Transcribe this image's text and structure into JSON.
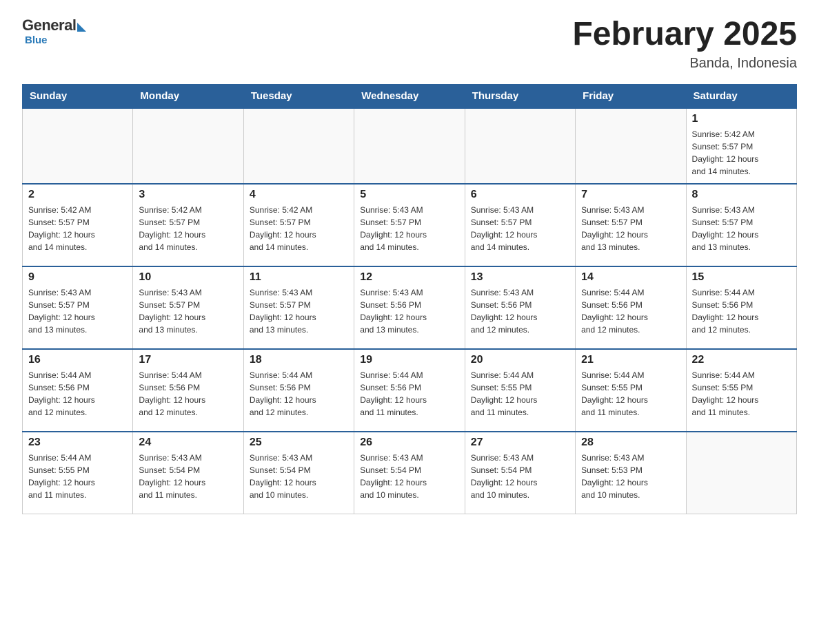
{
  "header": {
    "logo_general": "General",
    "logo_blue": "Blue",
    "month_title": "February 2025",
    "location": "Banda, Indonesia"
  },
  "weekdays": [
    "Sunday",
    "Monday",
    "Tuesday",
    "Wednesday",
    "Thursday",
    "Friday",
    "Saturday"
  ],
  "weeks": [
    [
      {
        "day": "",
        "info": ""
      },
      {
        "day": "",
        "info": ""
      },
      {
        "day": "",
        "info": ""
      },
      {
        "day": "",
        "info": ""
      },
      {
        "day": "",
        "info": ""
      },
      {
        "day": "",
        "info": ""
      },
      {
        "day": "1",
        "info": "Sunrise: 5:42 AM\nSunset: 5:57 PM\nDaylight: 12 hours\nand 14 minutes."
      }
    ],
    [
      {
        "day": "2",
        "info": "Sunrise: 5:42 AM\nSunset: 5:57 PM\nDaylight: 12 hours\nand 14 minutes."
      },
      {
        "day": "3",
        "info": "Sunrise: 5:42 AM\nSunset: 5:57 PM\nDaylight: 12 hours\nand 14 minutes."
      },
      {
        "day": "4",
        "info": "Sunrise: 5:42 AM\nSunset: 5:57 PM\nDaylight: 12 hours\nand 14 minutes."
      },
      {
        "day": "5",
        "info": "Sunrise: 5:43 AM\nSunset: 5:57 PM\nDaylight: 12 hours\nand 14 minutes."
      },
      {
        "day": "6",
        "info": "Sunrise: 5:43 AM\nSunset: 5:57 PM\nDaylight: 12 hours\nand 14 minutes."
      },
      {
        "day": "7",
        "info": "Sunrise: 5:43 AM\nSunset: 5:57 PM\nDaylight: 12 hours\nand 13 minutes."
      },
      {
        "day": "8",
        "info": "Sunrise: 5:43 AM\nSunset: 5:57 PM\nDaylight: 12 hours\nand 13 minutes."
      }
    ],
    [
      {
        "day": "9",
        "info": "Sunrise: 5:43 AM\nSunset: 5:57 PM\nDaylight: 12 hours\nand 13 minutes."
      },
      {
        "day": "10",
        "info": "Sunrise: 5:43 AM\nSunset: 5:57 PM\nDaylight: 12 hours\nand 13 minutes."
      },
      {
        "day": "11",
        "info": "Sunrise: 5:43 AM\nSunset: 5:57 PM\nDaylight: 12 hours\nand 13 minutes."
      },
      {
        "day": "12",
        "info": "Sunrise: 5:43 AM\nSunset: 5:56 PM\nDaylight: 12 hours\nand 13 minutes."
      },
      {
        "day": "13",
        "info": "Sunrise: 5:43 AM\nSunset: 5:56 PM\nDaylight: 12 hours\nand 12 minutes."
      },
      {
        "day": "14",
        "info": "Sunrise: 5:44 AM\nSunset: 5:56 PM\nDaylight: 12 hours\nand 12 minutes."
      },
      {
        "day": "15",
        "info": "Sunrise: 5:44 AM\nSunset: 5:56 PM\nDaylight: 12 hours\nand 12 minutes."
      }
    ],
    [
      {
        "day": "16",
        "info": "Sunrise: 5:44 AM\nSunset: 5:56 PM\nDaylight: 12 hours\nand 12 minutes."
      },
      {
        "day": "17",
        "info": "Sunrise: 5:44 AM\nSunset: 5:56 PM\nDaylight: 12 hours\nand 12 minutes."
      },
      {
        "day": "18",
        "info": "Sunrise: 5:44 AM\nSunset: 5:56 PM\nDaylight: 12 hours\nand 12 minutes."
      },
      {
        "day": "19",
        "info": "Sunrise: 5:44 AM\nSunset: 5:56 PM\nDaylight: 12 hours\nand 11 minutes."
      },
      {
        "day": "20",
        "info": "Sunrise: 5:44 AM\nSunset: 5:55 PM\nDaylight: 12 hours\nand 11 minutes."
      },
      {
        "day": "21",
        "info": "Sunrise: 5:44 AM\nSunset: 5:55 PM\nDaylight: 12 hours\nand 11 minutes."
      },
      {
        "day": "22",
        "info": "Sunrise: 5:44 AM\nSunset: 5:55 PM\nDaylight: 12 hours\nand 11 minutes."
      }
    ],
    [
      {
        "day": "23",
        "info": "Sunrise: 5:44 AM\nSunset: 5:55 PM\nDaylight: 12 hours\nand 11 minutes."
      },
      {
        "day": "24",
        "info": "Sunrise: 5:43 AM\nSunset: 5:54 PM\nDaylight: 12 hours\nand 11 minutes."
      },
      {
        "day": "25",
        "info": "Sunrise: 5:43 AM\nSunset: 5:54 PM\nDaylight: 12 hours\nand 10 minutes."
      },
      {
        "day": "26",
        "info": "Sunrise: 5:43 AM\nSunset: 5:54 PM\nDaylight: 12 hours\nand 10 minutes."
      },
      {
        "day": "27",
        "info": "Sunrise: 5:43 AM\nSunset: 5:54 PM\nDaylight: 12 hours\nand 10 minutes."
      },
      {
        "day": "28",
        "info": "Sunrise: 5:43 AM\nSunset: 5:53 PM\nDaylight: 12 hours\nand 10 minutes."
      },
      {
        "day": "",
        "info": ""
      }
    ]
  ]
}
